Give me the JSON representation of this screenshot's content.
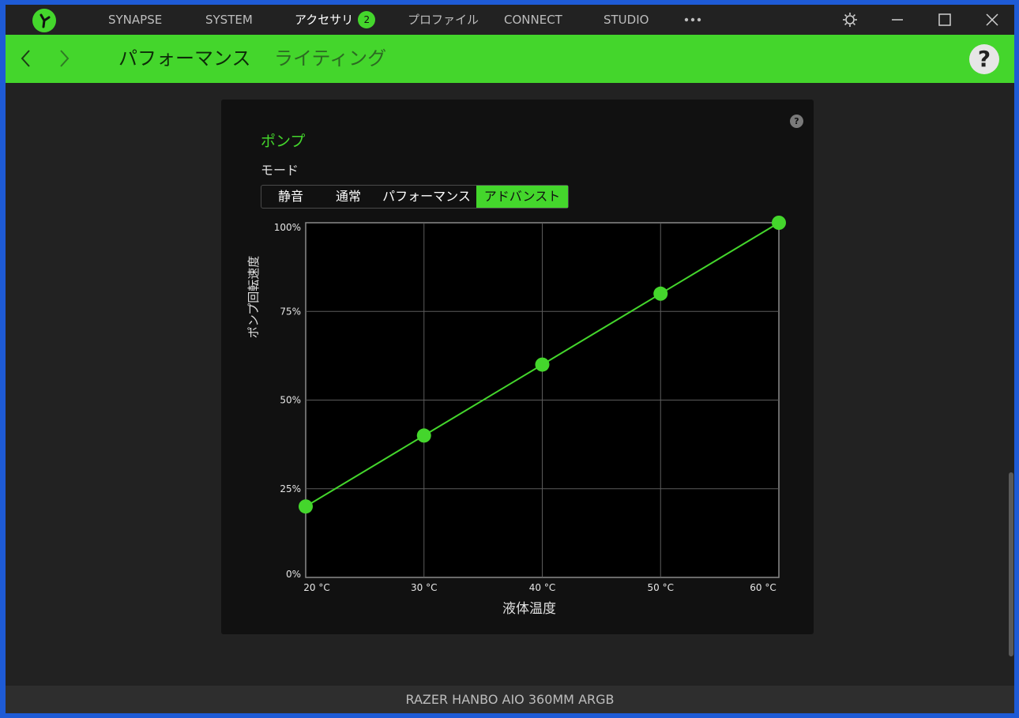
{
  "topnav": {
    "items": [
      {
        "label": "SYNAPSE"
      },
      {
        "label": "SYSTEM"
      },
      {
        "label": "アクセサリ",
        "badge": "2"
      },
      {
        "label": "プロファイル"
      },
      {
        "label": "CONNECT"
      },
      {
        "label": "STUDIO"
      }
    ],
    "more_icon": "more-horizontal-icon",
    "settings_icon": "gear-icon",
    "minimize_icon": "minimize-icon",
    "maximize_icon": "maximize-icon",
    "close_icon": "close-icon"
  },
  "subnav": {
    "back_icon": "chevron-left-icon",
    "forward_icon": "chevron-right-icon",
    "tabs": [
      {
        "label": "パフォーマンス"
      },
      {
        "label": "ライティング"
      }
    ],
    "help_label": "?"
  },
  "panel": {
    "help_label": "?",
    "title": "ポンプ",
    "mode_label": "モード",
    "modes": [
      {
        "label": "静音"
      },
      {
        "label": "通常"
      },
      {
        "label": "パフォーマンス"
      },
      {
        "label": "アドバンスト"
      }
    ],
    "selected_mode": "アドバンスト"
  },
  "chart_data": {
    "type": "line",
    "xlabel": "液体温度",
    "ylabel": "ポンプ回転速度",
    "x_ticks": [
      "20 °C",
      "30 °C",
      "40 °C",
      "50 °C",
      "60 °C"
    ],
    "y_ticks": [
      "0%",
      "25%",
      "50%",
      "75%",
      "100%"
    ],
    "xlim": [
      20,
      60
    ],
    "ylim": [
      0,
      100
    ],
    "grid": true,
    "line_color": "#44d62c",
    "series": [
      {
        "x": [
          20,
          30,
          40,
          50,
          60
        ],
        "y": [
          20,
          40,
          60,
          80,
          100
        ]
      }
    ]
  },
  "footer": {
    "device_name": "RAZER HANBO AIO 360MM ARGB"
  },
  "colors": {
    "accent": "#44d62c",
    "background": "#222222",
    "panel": "#111111"
  }
}
